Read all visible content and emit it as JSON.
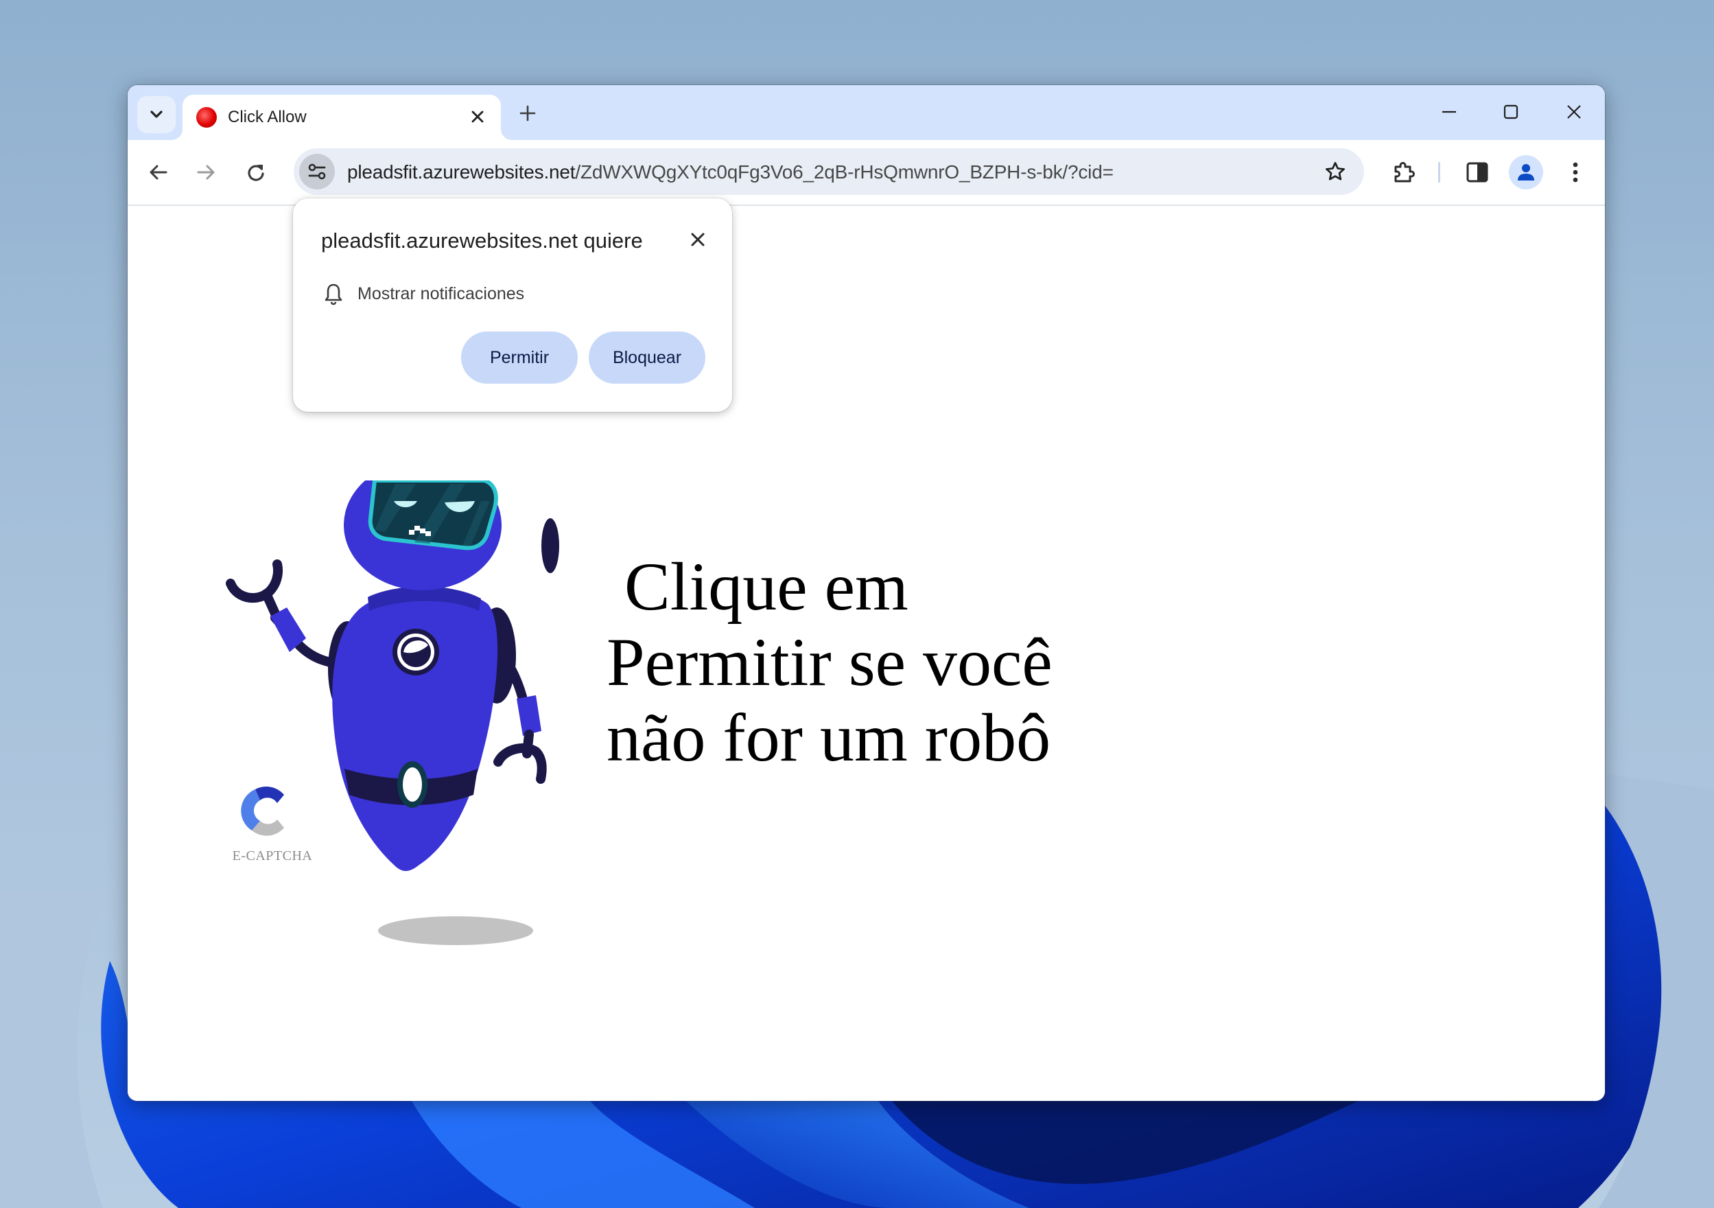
{
  "browser": {
    "tab": {
      "title": "Click Allow",
      "favicon": "red-circle-icon"
    },
    "new_tab_label": "+",
    "window_controls": [
      "minimize",
      "maximize",
      "close"
    ],
    "address_bar": {
      "host": "pleadsfit.azurewebsites.net",
      "path": "/ZdWXWQgXYtc0qFg3Vo6_2qB-rHsQmwnrO_BZPH-s-bk/?cid="
    },
    "toolbar_icons": [
      "back-icon",
      "forward-icon",
      "reload-icon",
      "site-info-icon",
      "bookmark-star-icon",
      "extensions-icon",
      "side-panel-icon",
      "profile-icon",
      "menu-icon"
    ]
  },
  "permission_popup": {
    "title": "pleadsfit.azurewebsites.net quiere",
    "permission": "Mostrar notificaciones",
    "allow_label": "Permitir",
    "block_label": "Bloquear"
  },
  "page": {
    "headline_lines": [
      "Clique em",
      "Permitir se você",
      "não for um robô"
    ],
    "logo_text": "E-CAPTCHA"
  },
  "colors": {
    "tabstrip_bg": "#d3e3fd",
    "omnibox_bg": "#e9eef6",
    "popup_button_bg": "#c7d8f9",
    "robot_body": "#3a33d6",
    "robot_dark": "#1b1747",
    "robot_visor": "#0e3a4a",
    "robot_visor_border": "#2bc4cf",
    "captcha_dark_blue": "#2233b5",
    "captcha_light_blue": "#4f7fe8",
    "captcha_grey": "#bdbdbd"
  }
}
